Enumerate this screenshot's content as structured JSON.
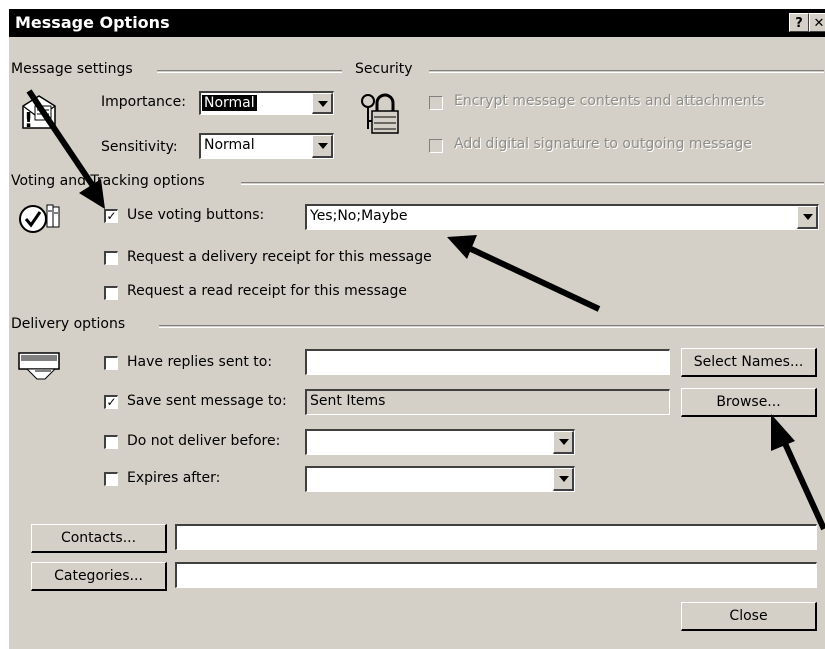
{
  "window": {
    "title": "Message Options",
    "help_label": "?",
    "close_label": "✕"
  },
  "message_settings": {
    "group_label": "Message settings",
    "importance_label": "Importance:",
    "importance_value": "Normal",
    "sensitivity_label": "Sensitivity:",
    "sensitivity_value": "Normal"
  },
  "security": {
    "group_label": "Security",
    "encrypt_label": "Encrypt message contents and attachments",
    "signature_label": "Add digital signature to outgoing message"
  },
  "voting": {
    "group_label": "Voting and Tracking options",
    "use_voting_label": "Use voting buttons:",
    "use_voting_checked": "✓",
    "voting_value": "Yes;No;Maybe",
    "delivery_receipt_label": "Request a delivery receipt for this message",
    "read_receipt_label": "Request a read receipt for this message"
  },
  "delivery": {
    "group_label": "Delivery options",
    "replies_label": "Have replies sent to:",
    "replies_value": "",
    "select_names_label": "Select Names...",
    "save_sent_label": "Save sent message to:",
    "save_sent_checked": "✓",
    "save_sent_value": "Sent Items",
    "browse_label": "Browse...",
    "not_before_label": "Do not deliver before:",
    "expires_label": "Expires after:"
  },
  "footer": {
    "contacts_label": "Contacts...",
    "categories_label": "Categories...",
    "close_label": "Close"
  }
}
